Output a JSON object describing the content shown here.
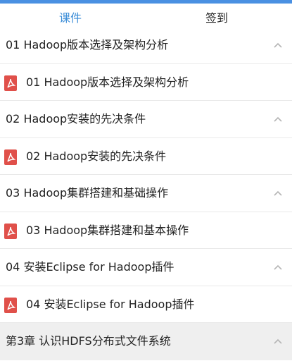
{
  "tabs": [
    {
      "label": "课件",
      "active": true
    },
    {
      "label": "签到",
      "active": false
    }
  ],
  "colors": {
    "accent": "#3d8ed8",
    "pdf_red": "#e0504a"
  },
  "rows": [
    {
      "type": "chapter",
      "title": "01 Hadoop版本选择及架构分析",
      "icon": "chevron-up-icon"
    },
    {
      "type": "item",
      "title": "01 Hadoop版本选择及架构分析",
      "icon": "pdf-icon"
    },
    {
      "type": "chapter",
      "title": "02 Hadoop安装的先决条件",
      "icon": "chevron-up-icon"
    },
    {
      "type": "item",
      "title": "02 Hadoop安装的先决条件",
      "icon": "pdf-icon"
    },
    {
      "type": "chapter",
      "title": "03 Hadoop集群搭建和基础操作",
      "icon": "chevron-up-icon"
    },
    {
      "type": "item",
      "title": "03 Hadoop集群搭建和基本操作",
      "icon": "pdf-icon"
    },
    {
      "type": "chapter",
      "title": "04 安装Eclipse for Hadoop插件",
      "icon": "chevron-up-icon"
    },
    {
      "type": "item",
      "title": "04 安装Eclipse for Hadoop插件",
      "icon": "pdf-icon"
    },
    {
      "type": "chapter",
      "title": "第3章  认识HDFS分布式文件系统",
      "icon": "chevron-up-icon"
    }
  ]
}
